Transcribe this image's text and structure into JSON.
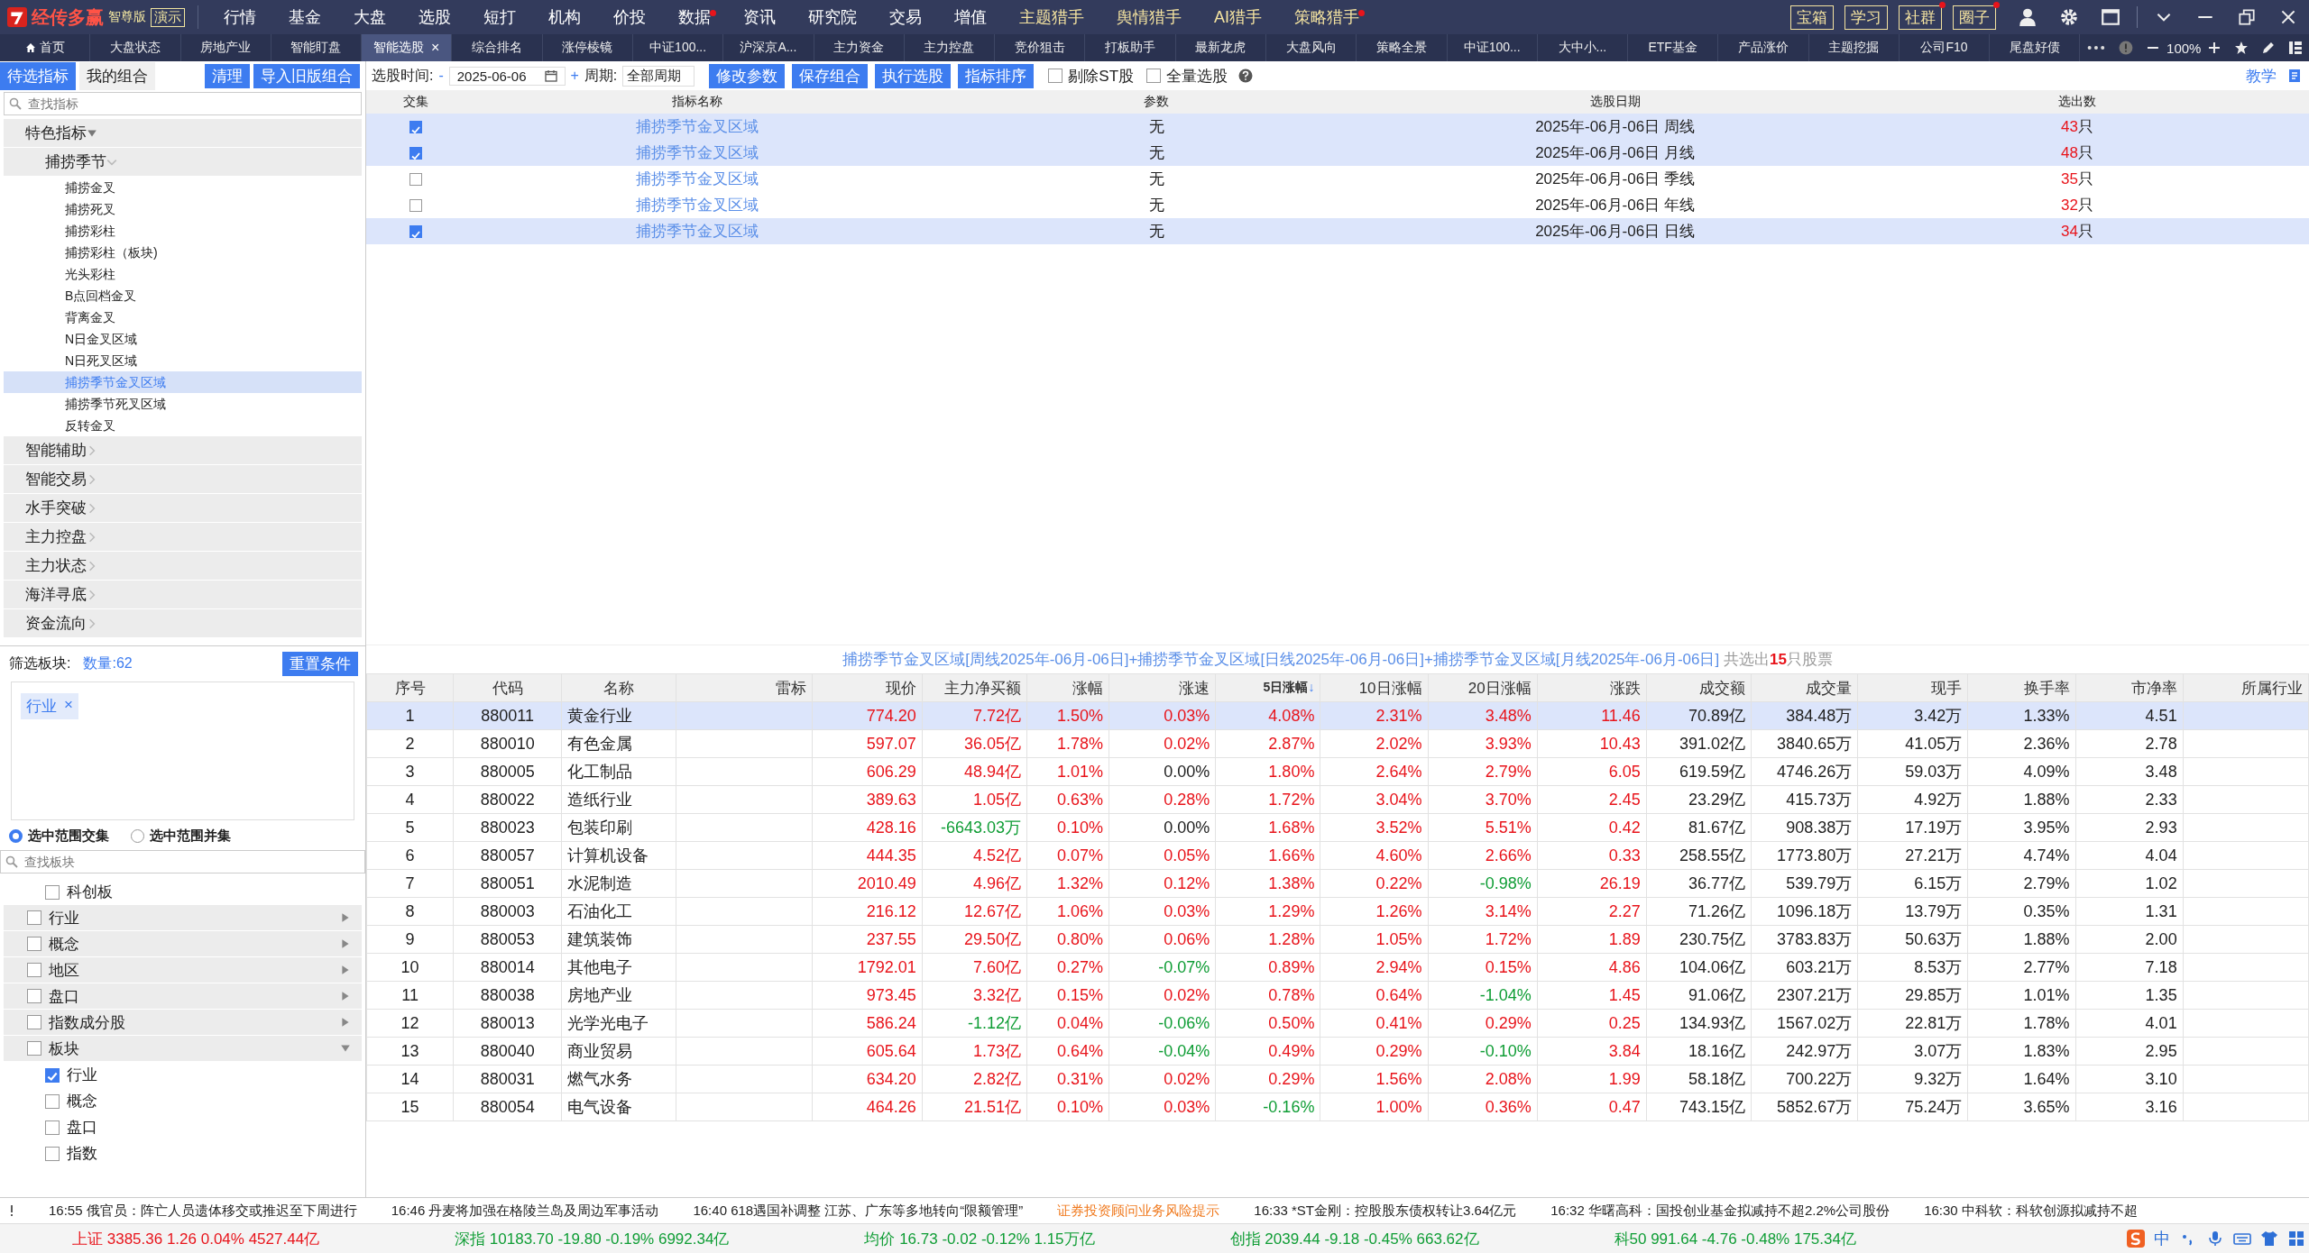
{
  "app": {
    "name": "经传多赢",
    "edition": "智尊版",
    "mode": "演示"
  },
  "menu": [
    {
      "label": "行情",
      "highlight": false,
      "dot": false
    },
    {
      "label": "基金",
      "highlight": false,
      "dot": false
    },
    {
      "label": "大盘",
      "highlight": false,
      "dot": false
    },
    {
      "label": "选股",
      "highlight": false,
      "dot": false
    },
    {
      "label": "短打",
      "highlight": false,
      "dot": false
    },
    {
      "label": "机构",
      "highlight": false,
      "dot": false
    },
    {
      "label": "价投",
      "highlight": false,
      "dot": false
    },
    {
      "label": "数据",
      "highlight": false,
      "dot": true
    },
    {
      "label": "资讯",
      "highlight": false,
      "dot": false
    },
    {
      "label": "研究院",
      "highlight": false,
      "dot": false
    },
    {
      "label": "交易",
      "highlight": false,
      "dot": false
    },
    {
      "label": "增值",
      "highlight": false,
      "dot": false
    },
    {
      "label": "主题猎手",
      "highlight": true,
      "dot": false
    },
    {
      "label": "舆情猎手",
      "highlight": true,
      "dot": false
    },
    {
      "label": "AI猎手",
      "highlight": true,
      "dot": false
    },
    {
      "label": "策略猎手",
      "highlight": true,
      "dot": true
    }
  ],
  "top_buttons": [
    {
      "label": "宝箱",
      "dot": false
    },
    {
      "label": "学习",
      "dot": false
    },
    {
      "label": "社群",
      "dot": true
    },
    {
      "label": "圈子",
      "dot": true
    }
  ],
  "tabs": [
    {
      "label": "首页",
      "selected": false,
      "kind": "home"
    },
    {
      "label": "大盘状态",
      "selected": false
    },
    {
      "label": "房地产业",
      "selected": false
    },
    {
      "label": "智能盯盘",
      "selected": false
    },
    {
      "label": "智能选股",
      "selected": true,
      "close": "×"
    },
    {
      "label": "综合排名",
      "selected": false
    },
    {
      "label": "涨停棱镜",
      "selected": false
    },
    {
      "label": "中证100...",
      "selected": false
    },
    {
      "label": "沪深京A...",
      "selected": false
    },
    {
      "label": "主力资金",
      "selected": false
    },
    {
      "label": "主力控盘",
      "selected": false
    },
    {
      "label": "竞价狙击",
      "selected": false
    },
    {
      "label": "打板助手",
      "selected": false
    },
    {
      "label": "最新龙虎",
      "selected": false
    },
    {
      "label": "大盘风向",
      "selected": false
    },
    {
      "label": "策略全景",
      "selected": false
    },
    {
      "label": "中证100...",
      "selected": false
    },
    {
      "label": "大中小...",
      "selected": false
    },
    {
      "label": "ETF基金",
      "selected": false
    },
    {
      "label": "产品涨价",
      "selected": false
    },
    {
      "label": "主题挖掘",
      "selected": false
    },
    {
      "label": "公司F10",
      "selected": false
    },
    {
      "label": "尾盘好债",
      "selected": false
    }
  ],
  "zoom": "100%",
  "left_tabs": [
    {
      "label": "待选指标",
      "selected": true
    },
    {
      "label": "我的组合",
      "selected": false
    }
  ],
  "left_buttons": [
    "清理",
    "导入旧版组合"
  ],
  "toolbar": {
    "time_label": "选股时间:",
    "minus": "-",
    "date": "2025-06-06",
    "plus": "+",
    "period_label": "周期:",
    "period": "全部周期",
    "buttons": [
      "修改参数",
      "保存组合",
      "执行选股",
      "指标排序"
    ],
    "options": [
      {
        "label": "剔除ST股",
        "checked": false
      },
      {
        "label": "全量选股",
        "checked": false
      }
    ],
    "link": "教学"
  },
  "indicator_search": {
    "placeholder": "查找指标"
  },
  "tree": [
    {
      "label": "特色指标",
      "expanded": true,
      "children": [
        {
          "label": "捕捞季节",
          "expanded": true,
          "children": [
            {
              "label": "捕捞金叉",
              "selected": false
            },
            {
              "label": "捕捞死叉",
              "selected": false
            },
            {
              "label": "捕捞彩柱",
              "selected": false
            },
            {
              "label": "捕捞彩柱（板块)",
              "selected": false
            },
            {
              "label": "光头彩柱",
              "selected": false
            },
            {
              "label": "B点回档金叉",
              "selected": false
            },
            {
              "label": "背离金叉",
              "selected": false
            },
            {
              "label": "N日金叉区域",
              "selected": false
            },
            {
              "label": "N日死叉区域",
              "selected": false
            },
            {
              "label": "捕捞季节金叉区域",
              "selected": true
            },
            {
              "label": "捕捞季节死叉区域",
              "selected": false
            },
            {
              "label": "反转金叉",
              "selected": false
            }
          ]
        }
      ]
    },
    {
      "label": "智能辅助",
      "expanded": false
    },
    {
      "label": "智能交易",
      "expanded": false
    },
    {
      "label": "水手突破",
      "expanded": false
    },
    {
      "label": "主力控盘",
      "expanded": false
    },
    {
      "label": "主力状态",
      "expanded": false
    },
    {
      "label": "海洋寻底",
      "expanded": false
    },
    {
      "label": "资金流向",
      "expanded": false
    }
  ],
  "filter": {
    "label": "筛选板块:",
    "count": "数量:62",
    "reset": "重置条件",
    "tags": [
      {
        "label": "行业",
        "remove": "×"
      }
    ],
    "modes": [
      {
        "label": "选中范围交集",
        "selected": true
      },
      {
        "label": "选中范围并集",
        "selected": false
      }
    ],
    "search": {
      "placeholder": "查找板块"
    },
    "items": [
      {
        "label": "科创板",
        "checked": false,
        "kind": "child"
      },
      {
        "label": "行业",
        "checked": false,
        "expanded": false
      },
      {
        "label": "概念",
        "checked": false,
        "expanded": false
      },
      {
        "label": "地区",
        "checked": false,
        "expanded": false
      },
      {
        "label": "盘口",
        "checked": false,
        "expanded": false
      },
      {
        "label": "指数成分股",
        "checked": false,
        "expanded": false
      },
      {
        "label": "板块",
        "checked": false,
        "expanded": true,
        "children": [
          {
            "label": "行业",
            "checked": true
          },
          {
            "label": "概念",
            "checked": false
          },
          {
            "label": "盘口",
            "checked": false
          },
          {
            "label": "指数",
            "checked": false
          }
        ]
      }
    ]
  },
  "indicators": {
    "columns": [
      "交集",
      "指标名称",
      "参数",
      "选股日期",
      "选出数"
    ],
    "rows": [
      {
        "checked": true,
        "name": "捕捞季节金叉区域",
        "param": "无",
        "date": "2025年-06月-06日 周线",
        "count": "43",
        "unit": "只"
      },
      {
        "checked": true,
        "name": "捕捞季节金叉区域",
        "param": "无",
        "date": "2025年-06月-06日 月线",
        "count": "48",
        "unit": "只"
      },
      {
        "checked": false,
        "name": "捕捞季节金叉区域",
        "param": "无",
        "date": "2025年-06月-06日 季线",
        "count": "35",
        "unit": "只"
      },
      {
        "checked": false,
        "name": "捕捞季节金叉区域",
        "param": "无",
        "date": "2025年-06月-06日 年线",
        "count": "32",
        "unit": "只"
      },
      {
        "checked": true,
        "name": "捕捞季节金叉区域",
        "param": "无",
        "date": "2025年-06月-06日 日线",
        "count": "34",
        "unit": "只"
      }
    ]
  },
  "summary": {
    "text": "捕捞季节金叉区域[周线2025年-06月-06日]+捕捞季节金叉区域[日线2025年-06月-06日]+捕捞季节金叉区域[月线2025年-06月-06日]",
    "total": "共选出**15**只股票"
  },
  "results": {
    "columns": [
      {
        "label": "序号",
        "kind": "no"
      },
      {
        "label": "代码",
        "kind": "code"
      },
      {
        "label": "名称",
        "kind": "name"
      },
      {
        "label": "雷标",
        "kind": "blank"
      },
      {
        "label": "现价",
        "kind": "follow"
      },
      {
        "label": "主力净买额",
        "kind": "signed"
      },
      {
        "label": "涨幅",
        "kind": "change"
      },
      {
        "label": "涨速",
        "kind": "signed"
      },
      {
        "label": "5日涨幅",
        "kind": "signed",
        "sort": "↓"
      },
      {
        "label": "10日涨幅",
        "kind": "signed"
      },
      {
        "label": "20日涨幅",
        "kind": "signed"
      },
      {
        "label": "涨跌",
        "kind": "follow"
      },
      {
        "label": "成交额",
        "kind": "plain"
      },
      {
        "label": "成交量",
        "kind": "plain"
      },
      {
        "label": "现手",
        "kind": "plain"
      },
      {
        "label": "换手率",
        "kind": "plain"
      },
      {
        "label": "市净率",
        "kind": "plain"
      },
      {
        "label": "所属行业",
        "kind": "blank"
      }
    ],
    "rows": [
      {
        "selected": true,
        "no": "1",
        "code": "880011",
        "name": "黄金行业",
        "values": [
          "774.20",
          "7.72亿",
          "1.50%",
          "0.03%",
          "4.08%",
          "2.31%",
          "3.48%",
          "11.46",
          "70.89亿",
          "384.48万",
          "3.42万",
          "1.33%",
          "4.51"
        ]
      },
      {
        "selected": false,
        "no": "2",
        "code": "880010",
        "name": "有色金属",
        "values": [
          "597.07",
          "36.05亿",
          "1.78%",
          "0.02%",
          "2.87%",
          "2.02%",
          "3.93%",
          "10.43",
          "391.02亿",
          "3840.65万",
          "41.05万",
          "2.36%",
          "2.78"
        ]
      },
      {
        "selected": false,
        "no": "3",
        "code": "880005",
        "name": "化工制品",
        "values": [
          "606.29",
          "48.94亿",
          "1.01%",
          "0.00%",
          "1.80%",
          "2.64%",
          "2.79%",
          "6.05",
          "619.59亿",
          "4746.26万",
          "59.03万",
          "4.09%",
          "3.48"
        ]
      },
      {
        "selected": false,
        "no": "4",
        "code": "880022",
        "name": "造纸行业",
        "values": [
          "389.63",
          "1.05亿",
          "0.63%",
          "0.28%",
          "1.72%",
          "3.04%",
          "3.70%",
          "2.45",
          "23.29亿",
          "415.73万",
          "4.92万",
          "1.88%",
          "2.33"
        ]
      },
      {
        "selected": false,
        "no": "5",
        "code": "880023",
        "name": "包装印刷",
        "values": [
          "428.16",
          "-6643.03万",
          "0.10%",
          "0.00%",
          "1.68%",
          "3.52%",
          "5.51%",
          "0.42",
          "81.67亿",
          "908.38万",
          "17.19万",
          "3.95%",
          "2.93"
        ]
      },
      {
        "selected": false,
        "no": "6",
        "code": "880057",
        "name": "计算机设备",
        "values": [
          "444.35",
          "4.52亿",
          "0.07%",
          "0.05%",
          "1.66%",
          "4.60%",
          "2.66%",
          "0.33",
          "258.55亿",
          "1773.80万",
          "27.21万",
          "4.74%",
          "4.04"
        ]
      },
      {
        "selected": false,
        "no": "7",
        "code": "880051",
        "name": "水泥制造",
        "values": [
          "2010.49",
          "4.96亿",
          "1.32%",
          "0.12%",
          "1.38%",
          "0.22%",
          "-0.98%",
          "26.19",
          "36.77亿",
          "539.79万",
          "6.15万",
          "2.79%",
          "1.02"
        ]
      },
      {
        "selected": false,
        "no": "8",
        "code": "880003",
        "name": "石油化工",
        "values": [
          "216.12",
          "12.67亿",
          "1.06%",
          "0.03%",
          "1.29%",
          "1.26%",
          "3.14%",
          "2.27",
          "71.26亿",
          "1096.18万",
          "13.79万",
          "0.35%",
          "1.31"
        ]
      },
      {
        "selected": false,
        "no": "9",
        "code": "880053",
        "name": "建筑装饰",
        "values": [
          "237.55",
          "29.50亿",
          "0.80%",
          "0.06%",
          "1.28%",
          "1.05%",
          "1.72%",
          "1.89",
          "230.75亿",
          "3783.83万",
          "50.63万",
          "1.88%",
          "2.00"
        ]
      },
      {
        "selected": false,
        "no": "10",
        "code": "880014",
        "name": "其他电子",
        "values": [
          "1792.01",
          "7.60亿",
          "0.27%",
          "-0.07%",
          "0.89%",
          "2.94%",
          "0.15%",
          "4.86",
          "104.06亿",
          "603.21万",
          "8.53万",
          "2.77%",
          "7.18"
        ]
      },
      {
        "selected": false,
        "no": "11",
        "code": "880038",
        "name": "房地产业",
        "values": [
          "973.45",
          "3.32亿",
          "0.15%",
          "0.02%",
          "0.78%",
          "0.64%",
          "-1.04%",
          "1.45",
          "91.06亿",
          "2307.21万",
          "29.85万",
          "1.01%",
          "1.35"
        ]
      },
      {
        "selected": false,
        "no": "12",
        "code": "880013",
        "name": "光学光电子",
        "values": [
          "586.24",
          "-1.12亿",
          "0.04%",
          "-0.06%",
          "0.50%",
          "0.41%",
          "0.29%",
          "0.25",
          "134.93亿",
          "1567.02万",
          "22.81万",
          "1.78%",
          "4.01"
        ]
      },
      {
        "selected": false,
        "no": "13",
        "code": "880040",
        "name": "商业贸易",
        "values": [
          "605.64",
          "1.73亿",
          "0.64%",
          "-0.04%",
          "0.49%",
          "0.29%",
          "-0.10%",
          "3.84",
          "18.16亿",
          "242.97万",
          "3.07万",
          "1.83%",
          "2.95"
        ]
      },
      {
        "selected": false,
        "no": "14",
        "code": "880031",
        "name": "燃气水务",
        "values": [
          "634.20",
          "2.82亿",
          "0.31%",
          "0.02%",
          "0.29%",
          "1.56%",
          "2.08%",
          "1.99",
          "58.18亿",
          "700.22万",
          "9.32万",
          "1.64%",
          "3.10"
        ]
      },
      {
        "selected": false,
        "no": "15",
        "code": "880054",
        "name": "电气设备",
        "values": [
          "464.26",
          "21.51亿",
          "0.10%",
          "0.03%",
          "-0.16%",
          "1.00%",
          "0.36%",
          "0.47",
          "743.15亿",
          "5852.67万",
          "75.24万",
          "3.65%",
          "3.16"
        ]
      }
    ]
  },
  "news": [
    {
      "text": "16:55 俄官员：阵亡人员遗体移交或推迟至下周进行",
      "kind": "news"
    },
    {
      "text": "16:46 丹麦将加强在格陵兰岛及周边军事活动",
      "kind": "news"
    },
    {
      "text": "16:40 618遇国补调整 江苏、广东等多地转向“限额管理”",
      "kind": "news"
    },
    {
      "text": "证券投资顾问业务风险提示",
      "kind": "notice"
    },
    {
      "text": "16:33 *ST金刚：控股股东债权转让3.64亿元",
      "kind": "news"
    },
    {
      "text": "16:32 华曙高科：国投创业基金拟减持不超2.2%公司股份",
      "kind": "news"
    },
    {
      "text": "16:30 中科软：科软创源拟减持不超",
      "kind": "news"
    }
  ],
  "indices": [
    {
      "name": "上证",
      "price": "3385.36",
      "change": "1.26",
      "pct": "0.04%",
      "amount": "4527.44亿"
    },
    {
      "name": "深指",
      "price": "10183.70",
      "change": "-19.80",
      "pct": "-0.19%",
      "amount": "6992.34亿"
    },
    {
      "name": "均价",
      "price": "16.73",
      "change": "-0.02",
      "pct": "-0.12%",
      "amount": "1.15万亿"
    },
    {
      "name": "创指",
      "price": "2039.44",
      "change": "-9.18",
      "pct": "-0.45%",
      "amount": "663.62亿"
    },
    {
      "name": "科50",
      "price": "991.64",
      "change": "-4.76",
      "pct": "-0.48%",
      "amount": "175.34亿"
    }
  ],
  "tray": {
    "ime": "中"
  }
}
